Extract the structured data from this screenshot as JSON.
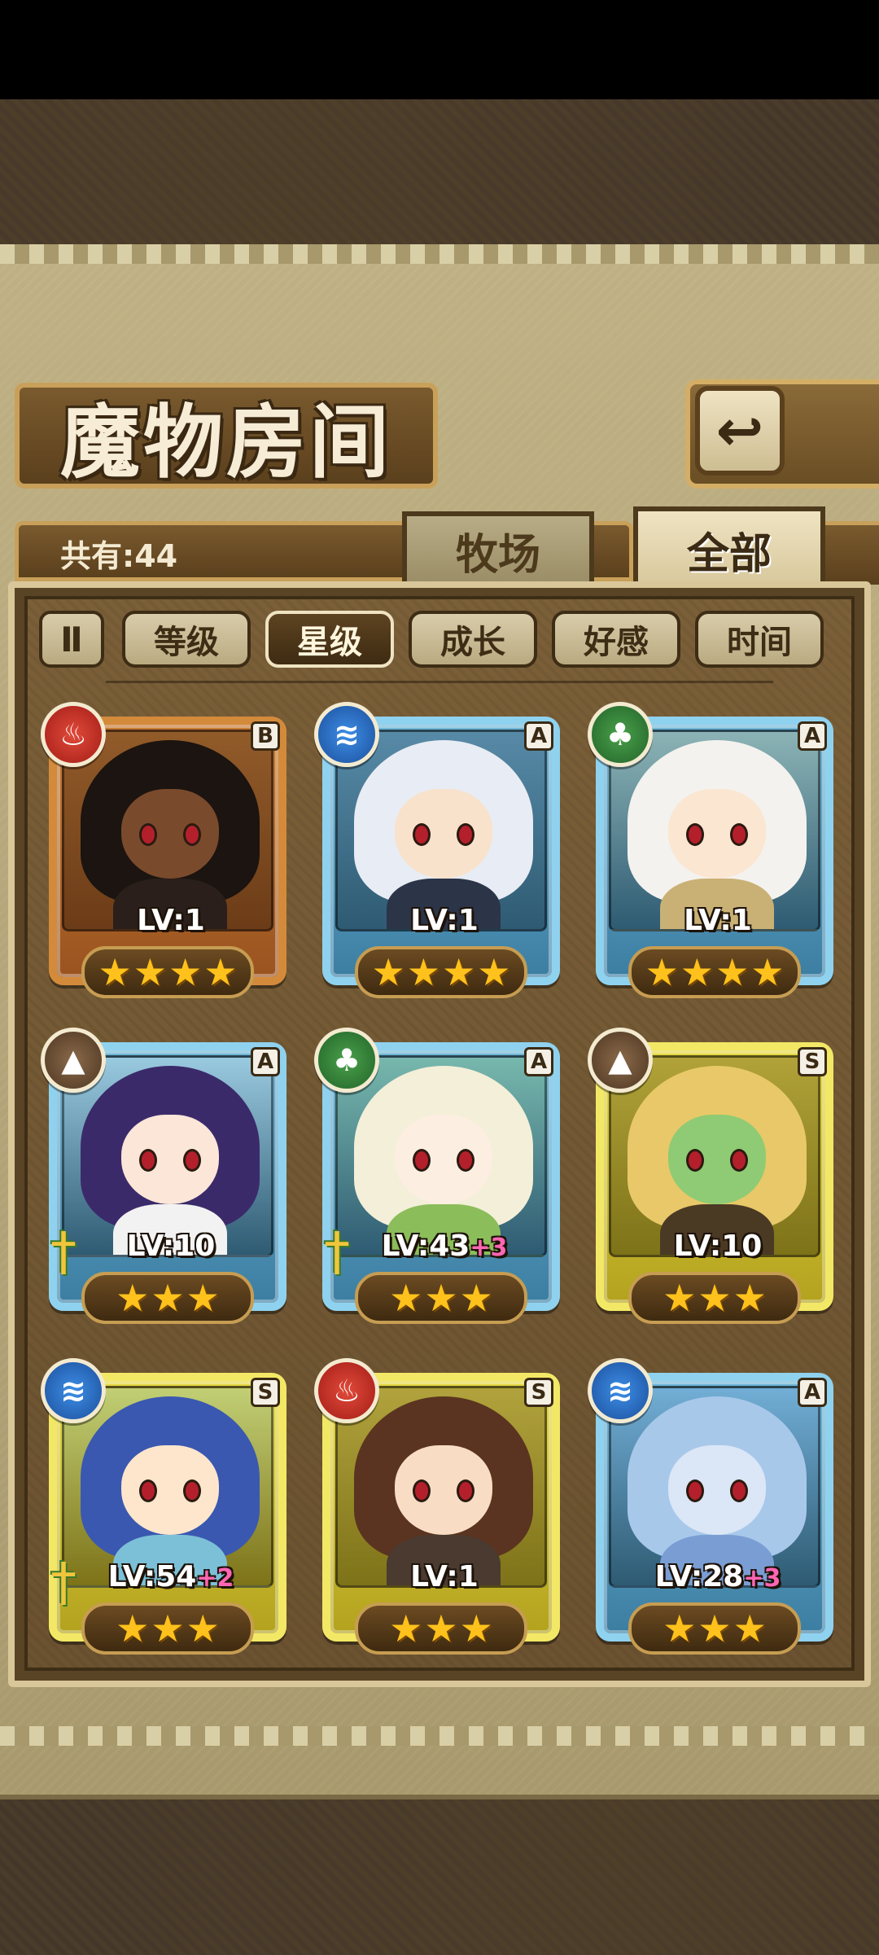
{
  "screen": {
    "title": "魔物房间",
    "back_icon": "return-arrow-icon",
    "count_text": "共有:44"
  },
  "tabs": [
    {
      "label": "牧场",
      "active": false
    },
    {
      "label": "全部",
      "active": true
    }
  ],
  "sort_toggle": {
    "icon": "pause-sort-icon",
    "label": "Ⅱ"
  },
  "filters": [
    {
      "label": "等级",
      "active": false
    },
    {
      "label": "星级",
      "active": true
    },
    {
      "label": "成长",
      "active": false
    },
    {
      "label": "好感",
      "active": false
    },
    {
      "label": "时间",
      "active": false
    }
  ],
  "monsters": [
    {
      "element": "fire",
      "element_icon": "fire-icon",
      "rank": "B",
      "level": "LV:1",
      "plus": "",
      "stars": 4,
      "weapon": false,
      "hair": "#1b1410",
      "skin": "#7a4a2c",
      "outfit": "#2a1f1a"
    },
    {
      "element": "water",
      "element_icon": "water-icon",
      "rank": "A",
      "level": "LV:1",
      "plus": "",
      "stars": 4,
      "weapon": false,
      "hair": "#e8ecf4",
      "skin": "#f8e2cc",
      "outfit": "#2c3448"
    },
    {
      "element": "wood",
      "element_icon": "leaf-icon",
      "rank": "A",
      "level": "LV:1",
      "plus": "",
      "stars": 4,
      "weapon": false,
      "hair": "#f4f2ee",
      "skin": "#fbe6d2",
      "outfit": "#c9b074"
    },
    {
      "element": "earth",
      "element_icon": "mountain-icon",
      "rank": "A",
      "level": "LV:10",
      "plus": "",
      "stars": 3,
      "weapon": true,
      "hair": "#3b2a6a",
      "skin": "#fbe6d8",
      "outfit": "#f2f2f2"
    },
    {
      "element": "wood",
      "element_icon": "leaf-icon",
      "rank": "A",
      "level": "LV:43",
      "plus": "+3",
      "stars": 3,
      "weapon": true,
      "hair": "#f4efd8",
      "skin": "#fdeee2",
      "outfit": "#8bbd5a"
    },
    {
      "element": "earth",
      "element_icon": "mountain-icon",
      "rank": "S",
      "level": "LV:10",
      "plus": "",
      "stars": 3,
      "weapon": false,
      "hair": "#e8c868",
      "skin": "#8ecb74",
      "outfit": "#4a3a24"
    },
    {
      "element": "water",
      "element_icon": "water-icon",
      "rank": "S",
      "level": "LV:54",
      "plus": "+2",
      "stars": 3,
      "weapon": true,
      "hair": "#3a58b0",
      "skin": "#fde6cc",
      "outfit": "#7cc0d8"
    },
    {
      "element": "fire",
      "element_icon": "fire-icon",
      "rank": "S",
      "level": "LV:1",
      "plus": "",
      "stars": 3,
      "weapon": false,
      "hair": "#5a3420",
      "skin": "#f8dcc4",
      "outfit": "#4a3a30"
    },
    {
      "element": "water",
      "element_icon": "water-icon",
      "rank": "A",
      "level": "LV:28",
      "plus": "+3",
      "stars": 3,
      "weapon": false,
      "hair": "#a8c8ea",
      "skin": "#dbe6f6",
      "outfit": "#7a9ed4"
    }
  ]
}
